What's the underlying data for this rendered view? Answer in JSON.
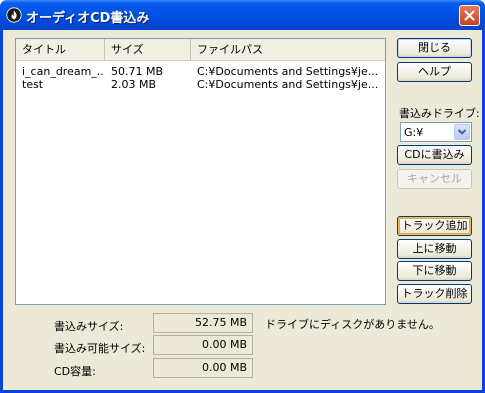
{
  "window": {
    "title": "オーディオCD書込み"
  },
  "list": {
    "columns": [
      "タイトル",
      "サイズ",
      "ファイルパス"
    ],
    "rows": [
      {
        "title": "i_can_dream_...",
        "size": "50.71 MB",
        "path": "C:¥Documents and Settings¥je..."
      },
      {
        "title": "test",
        "size": "2.03 MB",
        "path": "C:¥Documents and Settings¥je..."
      }
    ]
  },
  "buttons": {
    "close": "閉じる",
    "help": "ヘルプ",
    "burn_cd": "CDに書込み",
    "cancel": "キャンセル",
    "add_track": "トラック追加",
    "move_up": "上に移動",
    "move_down": "下に移動",
    "delete_track": "トラック削除"
  },
  "drive": {
    "label": "書込みドライブ:",
    "selected": "G:¥"
  },
  "stats": {
    "write_size_label": "書込みサイズ:",
    "write_size_value": "52.75 MB",
    "writable_size_label": "書込み可能サイズ:",
    "writable_size_value": "0.00 MB",
    "cd_capacity_label": "CD容量:",
    "cd_capacity_value": "0.00 MB"
  },
  "status_message": "ドライブにディスクがありません。",
  "icons": {
    "app": "app-flame-icon",
    "close": "close-x-icon",
    "dropdown": "chevron-down-icon"
  }
}
